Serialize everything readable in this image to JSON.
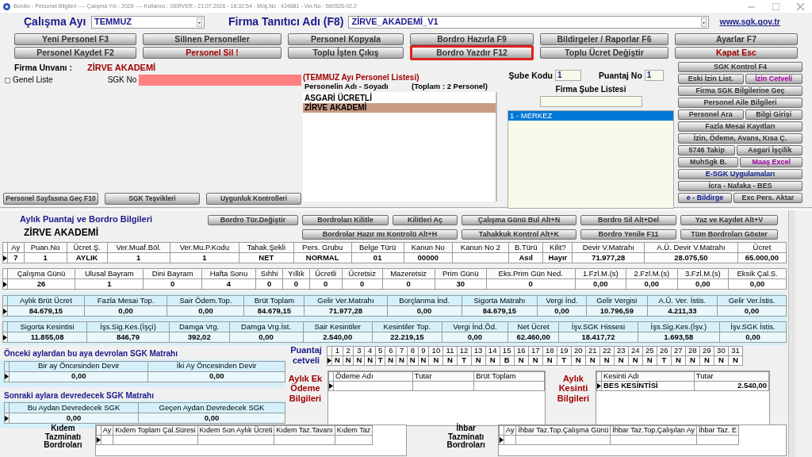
{
  "window": {
    "title": "Bordro - Personel Bilgileri ---- Çalışma Yılı : 2026 ---- Kullanıcı : SERVER - 21.07.2026 - 16:32:54 - Müş.No : 424681 - Ver.No : 060526-02.2"
  },
  "period": {
    "label": "Çalışma Ayı",
    "value": "TEMMUZ"
  },
  "company_id": {
    "label": "Firma Tanıtıcı Adı (F8)",
    "value": "ZİRVE_AKADEMİ_V1"
  },
  "link": "www.sgk.gov.tr",
  "top_buttons": [
    {
      "label": "Yeni Personel F3",
      "kind": "normal",
      "highlighted": false
    },
    {
      "label": "Silinen Personeller",
      "kind": "normal",
      "highlighted": false
    },
    {
      "label": "Personel Kopyala",
      "kind": "normal",
      "highlighted": false
    },
    {
      "label": "Bordro Hazırla F9",
      "kind": "normal",
      "highlighted": false
    },
    {
      "label": "Bildirgeler / Raporlar F6",
      "kind": "normal",
      "highlighted": false
    },
    {
      "label": "Ayarlar F7",
      "kind": "normal",
      "highlighted": false
    },
    {
      "label": "Personel Kaydet F2",
      "kind": "normal",
      "highlighted": false
    },
    {
      "label": "Personel Sil !",
      "kind": "danger",
      "highlighted": false
    },
    {
      "label": "Toplu İşten Çıkış",
      "kind": "normal",
      "highlighted": false
    },
    {
      "label": "Bordro Yazdır F12",
      "kind": "normal",
      "highlighted": true
    },
    {
      "label": "Toplu Ücret Değiştir",
      "kind": "normal",
      "highlighted": false
    },
    {
      "label": "Kapat Esc",
      "kind": "danger",
      "highlighted": false
    }
  ],
  "company_name": {
    "label": "Firma Unvanı :",
    "value": "ZİRVE AKADEMİ"
  },
  "general_list": {
    "label": "Genel Liste",
    "checked": false
  },
  "sgk_no": {
    "label": "SGK No"
  },
  "left_buttons": [
    "Personel Sayfasına Geç F10",
    "SGK Teşvikleri",
    "Uygunluk Kontrolleri"
  ],
  "personnel": {
    "title": "(TEMMUZ Ayı Personel Listesi)",
    "column": "Personelin Adı - Soyadı",
    "total": "(Toplam : 2 Personel)",
    "items": [
      {
        "name": "ASGARİ ÜCRETLİ",
        "selected": false
      },
      {
        "name": "ZİRVE AKADEMİ",
        "selected": true
      }
    ]
  },
  "branch": {
    "code_label": "Şube Kodu",
    "code": "1",
    "puantaj_label": "Puantaj No",
    "puantaj": "1",
    "list_title": "Firma Şube Listesi",
    "items": [
      {
        "name": "1 - MERKEZ",
        "selected": true
      }
    ]
  },
  "side_buttons": [
    [
      {
        "label": "SGK Kontrol F4",
        "kind": "normal"
      }
    ],
    [
      {
        "label": "Eski İzin List.",
        "kind": "normal"
      },
      {
        "label": "İzin Cetveli",
        "kind": "purple"
      }
    ],
    [
      {
        "label": "Firma SGK Bilgilerine Geç",
        "kind": "normal"
      }
    ],
    [
      {
        "label": "Personel Aile Bilgileri",
        "kind": "normal"
      }
    ],
    [
      {
        "label": "Personel Ara",
        "kind": "normal"
      },
      {
        "label": "Bilgi Girişi",
        "kind": "normal"
      }
    ],
    [
      {
        "label": "Fazla Mesai Kayıtları",
        "kind": "normal"
      }
    ],
    [
      {
        "label": "İzin, Ödeme, Avans, Kısa Ç.",
        "kind": "normal"
      }
    ],
    [
      {
        "label": "5746 Takip",
        "kind": "normal"
      },
      {
        "label": "Asgari İşçilik",
        "kind": "normal"
      }
    ],
    [
      {
        "label": "MuhSgk B.",
        "kind": "normal"
      },
      {
        "label": "Maaş Excel",
        "kind": "purple"
      }
    ],
    [
      {
        "label": "E-SGK Uygulamaları",
        "kind": "blue"
      }
    ],
    [
      {
        "label": "İcra - Nafaka - BES",
        "kind": "normal"
      }
    ],
    [
      {
        "label": "e - Bildirge",
        "kind": "blue"
      },
      {
        "label": "Exc Pers. Aktar",
        "kind": "normal"
      }
    ]
  ],
  "monthly": {
    "title": "Aylık Puantaj ve Bordro Bilgileri",
    "company": "ZİRVE AKADEMİ",
    "buttons_row1": [
      "Bordro Tür.Değiştir",
      "Bordroları Kilitle",
      "Kilitleri Aç",
      "Çalışma Günü Bul Alt+N",
      "Bordro Sil Alt+Del",
      "Yaz ve Kaydet Alt+V"
    ],
    "buttons_row2": [
      "Bordrolar Hazır mı Kontrolü Alt+H",
      "Tahakkuk Kontrol Alt+K",
      "Bordro Yenile F11",
      "Tüm Bordroları Göster"
    ]
  },
  "grids": [
    {
      "shaded": false,
      "columns": [
        "Ay",
        "Puan.No",
        "Ücret Ş.",
        "Ver.Muaf.Böl.",
        "Ver.Mu.P.Kodu",
        "Tahak.Şekli",
        "Pers. Grubu",
        "Belge Türü",
        "Kanun No",
        "Kanun No 2",
        "B.Türü",
        "Kilit?",
        "Devir V.Matrahı",
        "A.Ü. Devir V.Matrahı",
        "Ücret"
      ],
      "cells": [
        "7",
        "1",
        "AYLIK",
        "1",
        "1",
        "NET",
        "NORMAL",
        "01",
        "00000",
        null,
        "Asıl",
        "Hayır",
        "71.977,28",
        "28.075,50",
        "65.000,00"
      ]
    },
    {
      "shaded": false,
      "columns": [
        "Çalışma Günü",
        "Ulusal Bayram",
        "Dini Bayram",
        "Hafta Sonu",
        "Sıhhi",
        "Yıllık",
        "Ücretli",
        "Ücretsiz",
        "Mazeretsiz",
        "Prim Günü",
        "Eks.Prim Gün Ned.",
        "1.Fzl.M.(s)",
        "2.Fzl.M.(s)",
        "3.Fzl.M.(s)",
        "Eksik Çal.S."
      ],
      "cells": [
        "26",
        "1",
        "0",
        "4",
        "0",
        "0",
        "0",
        "0",
        "0",
        "30",
        "0",
        "0,00",
        "0,00",
        "0,00",
        "0,00"
      ]
    },
    {
      "shaded": true,
      "columns": [
        "Aylık Brüt Ücret",
        "Fazla Mesai Top.",
        "Sair Ödem.Top.",
        "Brüt Toplam",
        "Gelir Ver.Matrahı",
        "Borçlanma İnd.",
        "Sigorta Matrahı",
        "Vergi İnd.",
        "Gelir Vergisi",
        "A.Ü. Ver. İstis.",
        "Gelir Ver.İstis."
      ],
      "cells": [
        "84.679,15",
        "0,00",
        "0,00",
        "84.679,15",
        "71.977,28",
        "0,00",
        "84.679,15",
        "0,00",
        "10.796,59",
        "4.211,33",
        "0,00"
      ]
    },
    {
      "shaded": true,
      "columns": [
        "Sigorta Kesintisi",
        "İşs.Sig.Kes.(İşçi)",
        "Damga Vrg.",
        "Damga Vrg.İst.",
        "Sair Kesintiler",
        "Kesintiler Top.",
        "Vergi İnd.Öd.",
        "Net Ücret",
        "İşv.SGK Hissesi",
        "İşs.Sig.Kes.(İşv.)",
        "İşv.SGK İstis."
      ],
      "cells": [
        "11.855,08",
        "846,79",
        "392,02",
        "0,00",
        "2.540,00",
        "22.219,15",
        "0,00",
        "62.460,00",
        "18.417,72",
        "1.693,58",
        "0,00"
      ]
    }
  ],
  "carry_in": {
    "title": "Önceki aylardan bu aya devrolan SGK Matrahı",
    "columns": [
      "Bir ay Öncesinden Devir",
      "İki Ay Öncesinden Devir"
    ],
    "cells": [
      "0,00",
      "0,00"
    ]
  },
  "carry_out": {
    "title": "Sonraki aylara devredecek SGK Matrahı",
    "columns": [
      "Bu Aydan Devredecek SGK",
      "Geçen Aydan Devredecek SGK"
    ],
    "cells": [
      "0,00",
      "0,00"
    ]
  },
  "puantaj": {
    "label": "Puantaj cetveli",
    "days": [
      {
        "day": "1",
        "code": "N"
      },
      {
        "day": "2",
        "code": "N"
      },
      {
        "day": "3",
        "code": "N"
      },
      {
        "day": "4",
        "code": "N"
      },
      {
        "day": "5",
        "code": "T"
      },
      {
        "day": "6",
        "code": "N"
      },
      {
        "day": "7",
        "code": "N"
      },
      {
        "day": "8",
        "code": "N"
      },
      {
        "day": "9",
        "code": "N"
      },
      {
        "day": "10",
        "code": "N"
      },
      {
        "day": "11",
        "code": "N"
      },
      {
        "day": "12",
        "code": "T"
      },
      {
        "day": "13",
        "code": "N"
      },
      {
        "day": "14",
        "code": "N"
      },
      {
        "day": "15",
        "code": "B"
      },
      {
        "day": "16",
        "code": "N"
      },
      {
        "day": "17",
        "code": "N"
      },
      {
        "day": "18",
        "code": "N"
      },
      {
        "day": "19",
        "code": "T"
      },
      {
        "day": "20",
        "code": "N"
      },
      {
        "day": "21",
        "code": "N"
      },
      {
        "day": "22",
        "code": "N"
      },
      {
        "day": "23",
        "code": "N"
      },
      {
        "day": "24",
        "code": "N"
      },
      {
        "day": "25",
        "code": "N"
      },
      {
        "day": "26",
        "code": "T"
      },
      {
        "day": "27",
        "code": "N"
      },
      {
        "day": "28",
        "code": "N"
      },
      {
        "day": "29",
        "code": "N"
      },
      {
        "day": "30",
        "code": "N"
      },
      {
        "day": "31",
        "code": "N"
      }
    ]
  },
  "extra_pay": {
    "label": "Aylık Ek Ödeme Bilgileri",
    "columns": [
      "Ödeme Adı",
      "Tutar",
      "Brüt Toplam"
    ]
  },
  "deductions": {
    "label": "Aylık Kesinti Bilgileri",
    "columns": [
      "Kesinti Adı",
      "Tutar"
    ],
    "rows": [
      [
        "BES KESİNTİSİ",
        "2.540,00"
      ]
    ]
  },
  "severance": {
    "label": "Kıdem Tazminatı Bordroları",
    "columns": [
      "Ay",
      "Kıdem Toplam Çal.Süresi",
      "Kıdem Son Aylık Ücreti",
      "Kıdem Taz.Tavanı",
      "Kıdem Taz"
    ]
  },
  "notice": {
    "label": "İhbar Tazminatı Bordroları",
    "columns": [
      "Ay",
      "İhbar Taz.Top.Çalışma Günü",
      "İhbar Taz.Top.Çalışılan Ay",
      "İhbar Taz. E"
    ]
  }
}
